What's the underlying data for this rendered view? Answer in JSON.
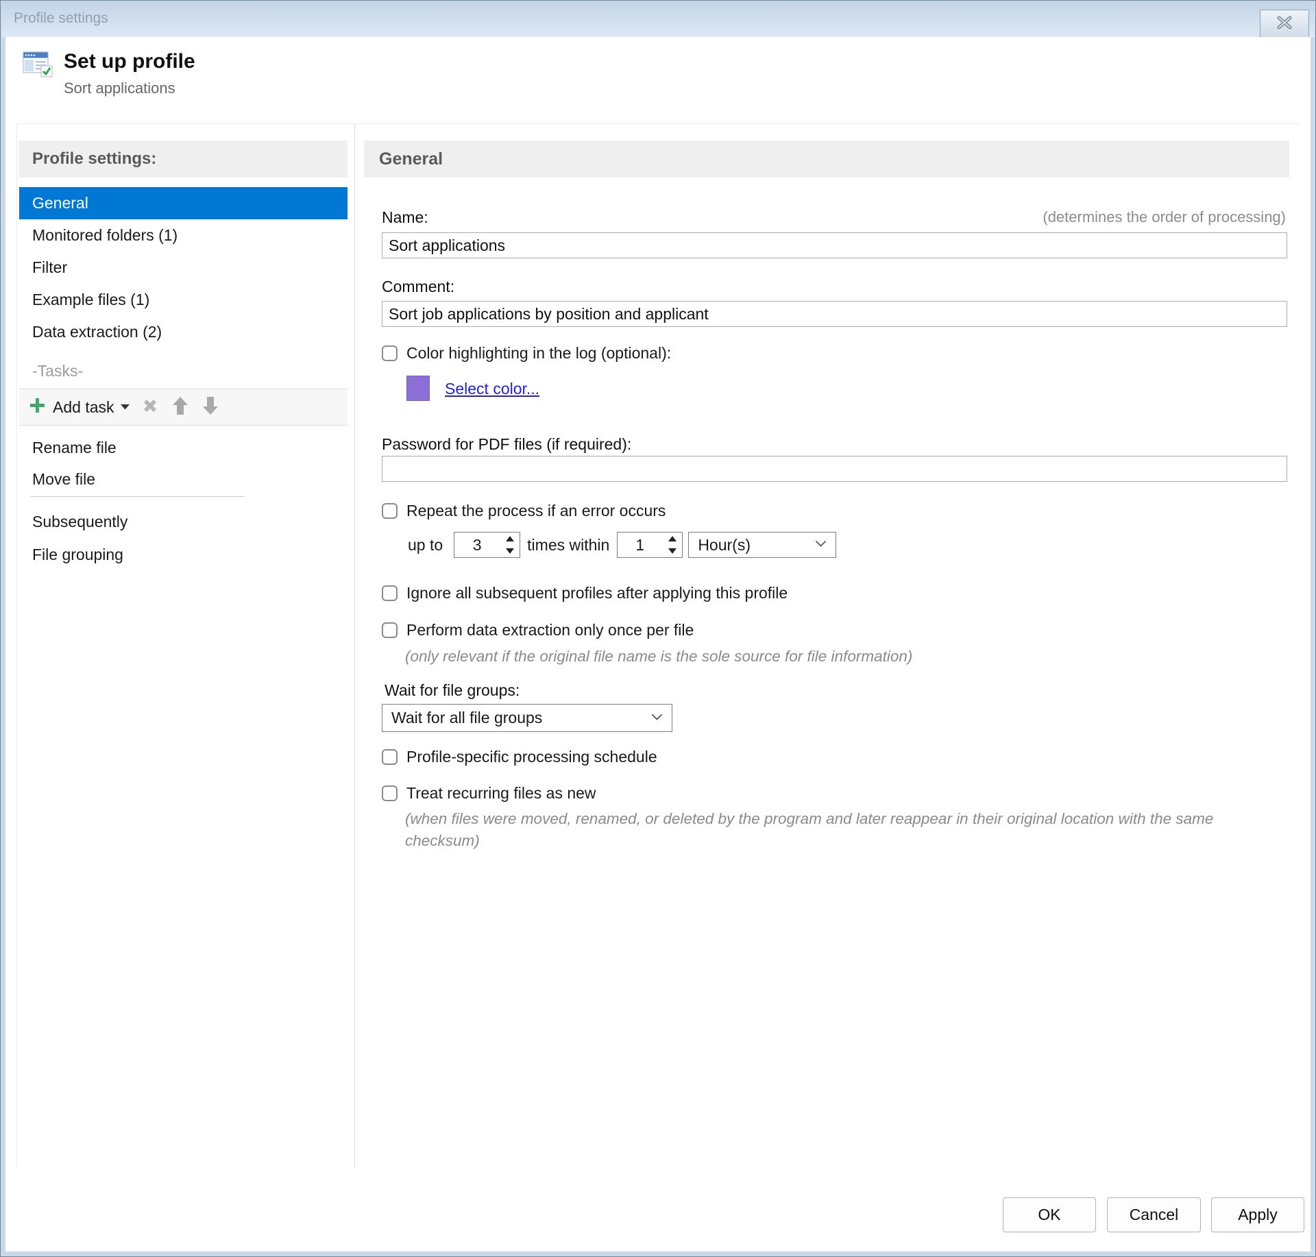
{
  "window": {
    "title": "Profile settings"
  },
  "header": {
    "title": "Set up profile",
    "subtitle": "Sort applications"
  },
  "sidebar": {
    "header": "Profile settings:",
    "items": [
      {
        "label": "General",
        "selected": true
      },
      {
        "label": "Monitored folders (1)",
        "selected": false
      },
      {
        "label": "Filter",
        "selected": false
      },
      {
        "label": "Example files (1)",
        "selected": false
      },
      {
        "label": "Data extraction (2)",
        "selected": false
      }
    ],
    "tasks_label": "-Tasks-",
    "toolbar": {
      "add_task_label": "Add task"
    },
    "task_items": [
      {
        "label": "Rename file"
      },
      {
        "label": "Move file"
      }
    ],
    "after_items": [
      {
        "label": "Subsequently"
      },
      {
        "label": "File grouping"
      }
    ]
  },
  "main": {
    "section_title": "General",
    "name": {
      "label": "Name:",
      "hint": "(determines the order of processing)",
      "value": "Sort applications"
    },
    "comment": {
      "label": "Comment:",
      "value": "Sort job applications by position and applicant"
    },
    "color_highlighting": {
      "label": "Color highlighting in the log (optional):",
      "checked": false,
      "swatch_color": "#8b6fd7",
      "link": "Select color..."
    },
    "password": {
      "label": "Password for PDF files (if required):",
      "value": ""
    },
    "repeat": {
      "label": "Repeat the process if an error occurs",
      "checked": false,
      "prefix": "up to",
      "count": "3",
      "middle": "times within",
      "interval": "1",
      "unit": "Hour(s)"
    },
    "ignore_subsequent": {
      "label": "Ignore all subsequent profiles after applying this profile",
      "checked": false
    },
    "extract_once": {
      "label": "Perform data extraction only once per file",
      "checked": false,
      "note": "(only relevant if the original file name is the sole source for file information)"
    },
    "wait_groups": {
      "label": "Wait for file groups:",
      "value": "Wait for all file groups"
    },
    "schedule": {
      "label": "Profile-specific processing schedule",
      "checked": false
    },
    "recurring": {
      "label": "Treat recurring files as new",
      "checked": false,
      "note": "(when files were moved, renamed, or deleted by the program and later reappear in their original location with the same checksum)"
    }
  },
  "footer": {
    "ok": "OK",
    "cancel": "Cancel",
    "apply": "Apply"
  },
  "colors": {
    "selection_blue": "#0078d4",
    "swatch_purple": "#8b6fd7",
    "link_blue": "#2020dd",
    "add_icon_green": "#43a56f",
    "titlebar_blue": "#d3e1ef"
  }
}
